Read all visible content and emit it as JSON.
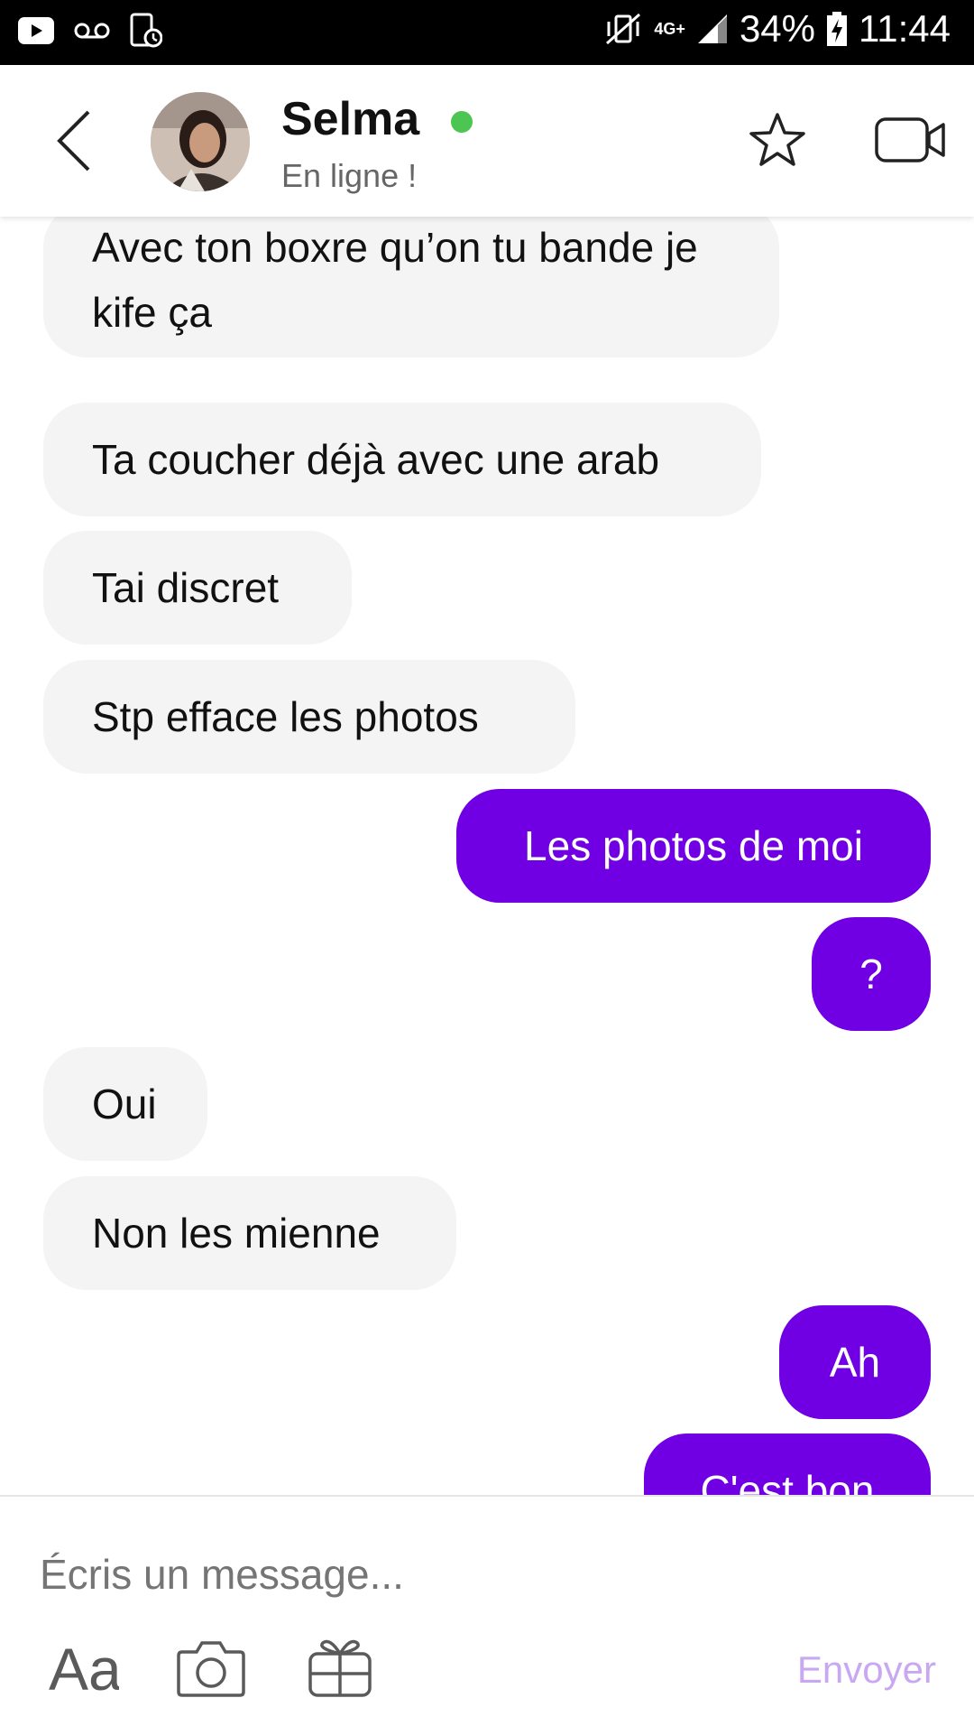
{
  "statusbar": {
    "battery": "34%",
    "time": "11:44",
    "network": "4G+"
  },
  "contact": {
    "name": "Selma",
    "status": "En ligne !"
  },
  "messages": [
    {
      "from": "them",
      "text": "Avec ton boxre  qu’on tu bande je kife ça"
    },
    {
      "from": "them",
      "text": "Ta coucher déjà avec une arab"
    },
    {
      "from": "them",
      "text": "Tai discret"
    },
    {
      "from": "them",
      "text": "Stp efface les photos"
    },
    {
      "from": "me",
      "text": "Les photos de moi"
    },
    {
      "from": "me",
      "text": "?"
    },
    {
      "from": "them",
      "text": "Oui"
    },
    {
      "from": "them",
      "text": "Non les mienne"
    },
    {
      "from": "me",
      "text": "Ah"
    },
    {
      "from": "me",
      "text": "C'est bon"
    }
  ],
  "composer": {
    "placeholder": "Écris un message...",
    "send_label": "Envoyer",
    "font_tool_label": "Aa"
  },
  "colors": {
    "outgoing": "#7000e3",
    "incoming": "#f4f4f4",
    "online": "#4cc552",
    "send_disabled": "#c9a8f2"
  }
}
